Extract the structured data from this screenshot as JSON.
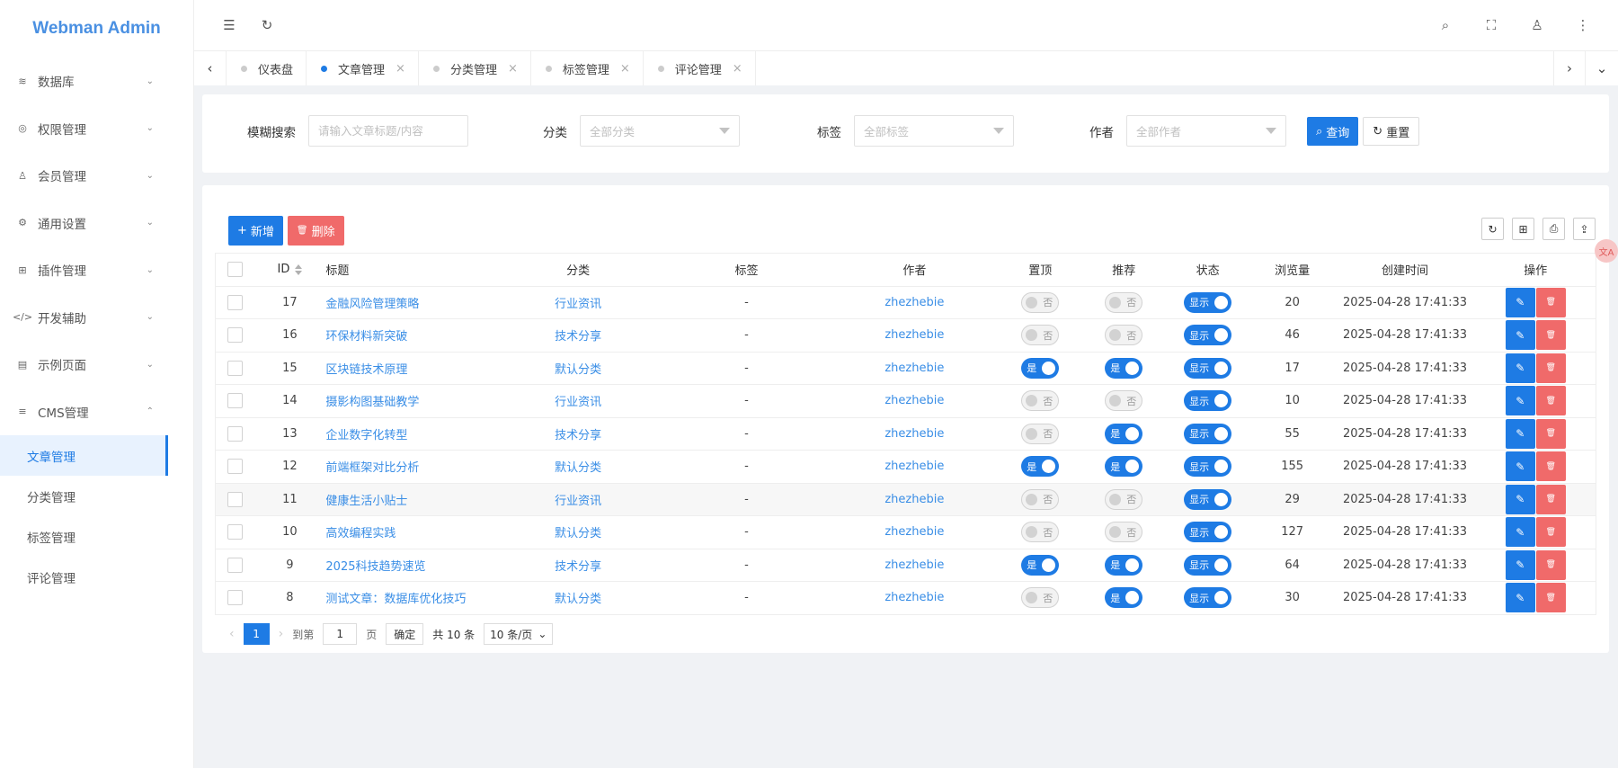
{
  "app": {
    "title": "Webman Admin"
  },
  "sidebar": {
    "items": [
      {
        "label": "数据库",
        "icon": "database-icon",
        "glyph": "≋",
        "chev": "⌄"
      },
      {
        "label": "权限管理",
        "icon": "shield-icon",
        "glyph": "◎",
        "chev": "⌄"
      },
      {
        "label": "会员管理",
        "icon": "user-icon",
        "glyph": "♙",
        "chev": "⌄"
      },
      {
        "label": "通用设置",
        "icon": "gear-icon",
        "glyph": "⚙",
        "chev": "⌄"
      },
      {
        "label": "插件管理",
        "icon": "plugin-icon",
        "glyph": "⊞",
        "chev": "⌄"
      },
      {
        "label": "开发辅助",
        "icon": "code-icon",
        "glyph": "</>",
        "chev": "⌄"
      },
      {
        "label": "示例页面",
        "icon": "example-icon",
        "glyph": "▤",
        "chev": "⌄"
      },
      {
        "label": "CMS管理",
        "icon": "cms-icon",
        "glyph": "≡",
        "chev": "⌃"
      }
    ],
    "sub_items": [
      "文章管理",
      "分类管理",
      "标签管理",
      "评论管理"
    ]
  },
  "header": {
    "icons": {
      "menu": "☰",
      "refresh": "↻",
      "search": "⌕",
      "fullscreen": "⛶",
      "user": "♙",
      "more": "⋮"
    }
  },
  "tabs": {
    "items": [
      "仪表盘",
      "文章管理",
      "分类管理",
      "标签管理",
      "评论管理"
    ],
    "active_index": 1,
    "close": "×",
    "prev": "‹",
    "next": "›",
    "dropdown": "⌄"
  },
  "search": {
    "keyword_label": "模糊搜索",
    "keyword_placeholder": "请输入文章标题/内容",
    "category_label": "分类",
    "category_placeholder": "全部分类",
    "tag_label": "标签",
    "tag_placeholder": "全部标签",
    "author_label": "作者",
    "author_placeholder": "全部作者",
    "query_button": "查询",
    "reset_button": "重置",
    "query_glyph": "⌕",
    "reset_glyph": "↻"
  },
  "toolbar": {
    "add_button": "新增",
    "add_glyph": "+",
    "delete_button": "删除",
    "delete_glyph": "🗑",
    "right_glyphs": {
      "refresh": "↻",
      "columns": "⊞",
      "print": "⎙",
      "export": "⇪"
    }
  },
  "table": {
    "headers": [
      "ID",
      "标题",
      "分类",
      "标签",
      "作者",
      "置顶",
      "推荐",
      "状态",
      "浏览量",
      "创建时间",
      "操作"
    ],
    "switch_labels": {
      "yes": "是",
      "no": "否",
      "show": "显示"
    },
    "action_glyphs": {
      "edit": "✎",
      "delete": "🗑"
    },
    "rows": [
      {
        "id": "17",
        "title": "金融风险管理策略",
        "category": "行业资讯",
        "tag": "-",
        "author": "zhezhebie",
        "top": false,
        "recommend": false,
        "status": true,
        "views": "20",
        "created": "2025-04-28 17:41:33"
      },
      {
        "id": "16",
        "title": "环保材料新突破",
        "category": "技术分享",
        "tag": "-",
        "author": "zhezhebie",
        "top": false,
        "recommend": false,
        "status": true,
        "views": "46",
        "created": "2025-04-28 17:41:33"
      },
      {
        "id": "15",
        "title": "区块链技术原理",
        "category": "默认分类",
        "tag": "-",
        "author": "zhezhebie",
        "top": true,
        "recommend": true,
        "status": true,
        "views": "17",
        "created": "2025-04-28 17:41:33"
      },
      {
        "id": "14",
        "title": "摄影构图基础教学",
        "category": "行业资讯",
        "tag": "-",
        "author": "zhezhebie",
        "top": false,
        "recommend": false,
        "status": true,
        "views": "10",
        "created": "2025-04-28 17:41:33"
      },
      {
        "id": "13",
        "title": "企业数字化转型",
        "category": "技术分享",
        "tag": "-",
        "author": "zhezhebie",
        "top": false,
        "recommend": true,
        "status": true,
        "views": "55",
        "created": "2025-04-28 17:41:33"
      },
      {
        "id": "12",
        "title": "前端框架对比分析",
        "category": "默认分类",
        "tag": "-",
        "author": "zhezhebie",
        "top": true,
        "recommend": true,
        "status": true,
        "views": "155",
        "created": "2025-04-28 17:41:33"
      },
      {
        "id": "11",
        "title": "健康生活小贴士",
        "category": "行业资讯",
        "tag": "-",
        "author": "zhezhebie",
        "top": false,
        "recommend": false,
        "status": true,
        "views": "29",
        "created": "2025-04-28 17:41:33"
      },
      {
        "id": "10",
        "title": "高效编程实践",
        "category": "默认分类",
        "tag": "-",
        "author": "zhezhebie",
        "top": false,
        "recommend": false,
        "status": true,
        "views": "127",
        "created": "2025-04-28 17:41:33"
      },
      {
        "id": "9",
        "title": "2025科技趋势速览",
        "category": "技术分享",
        "tag": "-",
        "author": "zhezhebie",
        "top": true,
        "recommend": true,
        "status": true,
        "views": "64",
        "created": "2025-04-28 17:41:33"
      },
      {
        "id": "8",
        "title": "测试文章：数据库优化技巧",
        "category": "默认分类",
        "tag": "-",
        "author": "zhezhebie",
        "top": false,
        "recommend": true,
        "status": true,
        "views": "30",
        "created": "2025-04-28 17:41:33"
      }
    ]
  },
  "pagination": {
    "prev": "‹",
    "next": "›",
    "current_page": "1",
    "goto_label": "到第",
    "goto_value": "1",
    "page_unit": "页",
    "confirm": "确定",
    "total": "共 10 条",
    "page_size": "10 条/页",
    "page_size_caret": "⌄"
  },
  "badge": {
    "text": "文A"
  },
  "colors": {
    "primary": "#1e7be4",
    "danger": "#f06a6a",
    "link": "#3a8ee6",
    "logo": "#4a90e2"
  }
}
